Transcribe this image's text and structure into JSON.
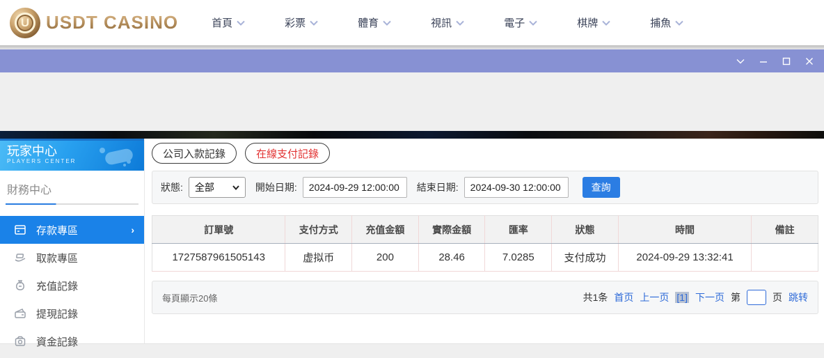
{
  "brand": {
    "name": "USDT CASINO",
    "logo_letter": "U"
  },
  "nav": {
    "items": [
      {
        "label": "首頁"
      },
      {
        "label": "彩票"
      },
      {
        "label": "體育"
      },
      {
        "label": "視訊"
      },
      {
        "label": "電子"
      },
      {
        "label": "棋牌"
      },
      {
        "label": "捕魚"
      }
    ]
  },
  "titlebar": {
    "controls": [
      "chevron-down-icon",
      "minimize-icon",
      "maximize-icon",
      "close-icon"
    ]
  },
  "sidebar": {
    "header": {
      "title": "玩家中心",
      "subtitle": "PLAYERS CENTER"
    },
    "section_title": "財務中心",
    "items": [
      {
        "label": "存款專區",
        "icon": "deposit-card-icon",
        "active": true
      },
      {
        "label": "取款專區",
        "icon": "withdraw-hand-icon",
        "active": false
      },
      {
        "label": "充值記錄",
        "icon": "money-bag-icon",
        "active": false
      },
      {
        "label": "提現記錄",
        "icon": "wallet-icon",
        "active": false
      },
      {
        "label": "資金記錄",
        "icon": "coin-purse-icon",
        "active": false
      }
    ]
  },
  "tabs": [
    {
      "label": "公司入款記錄",
      "active": false
    },
    {
      "label": "在線支付記錄",
      "active": true
    }
  ],
  "filters": {
    "status_label": "狀態:",
    "status_value": "全部",
    "start_label": "開始日期:",
    "start_value": "2024-09-29 12:00:00",
    "end_label": "結束日期:",
    "end_value": "2024-09-30 12:00:00",
    "query_button": "查詢"
  },
  "table": {
    "columns": [
      "訂單號",
      "支付方式",
      "充值金額",
      "實際金額",
      "匯率",
      "狀態",
      "時間",
      "備註"
    ],
    "rows": [
      [
        "1727587961505143",
        "虚拟币",
        "200",
        "28.46",
        "7.0285",
        "支付成功",
        "2024-09-29 13:32:41",
        ""
      ]
    ]
  },
  "pagination": {
    "page_size_text": "每頁顯示20條",
    "total_text": "共1条",
    "first": "首页",
    "prev": "上一页",
    "current": "[1]",
    "next": "下一页",
    "jump_prefix": "第",
    "jump_suffix": "页",
    "jump_action": "跳转"
  },
  "colors": {
    "accent_blue": "#1a82e8",
    "link_blue": "#2f6bd8",
    "tab_active_red": "#e23333",
    "brand_gold": "#b08a58",
    "titlebar_purple": "#8791d3"
  }
}
